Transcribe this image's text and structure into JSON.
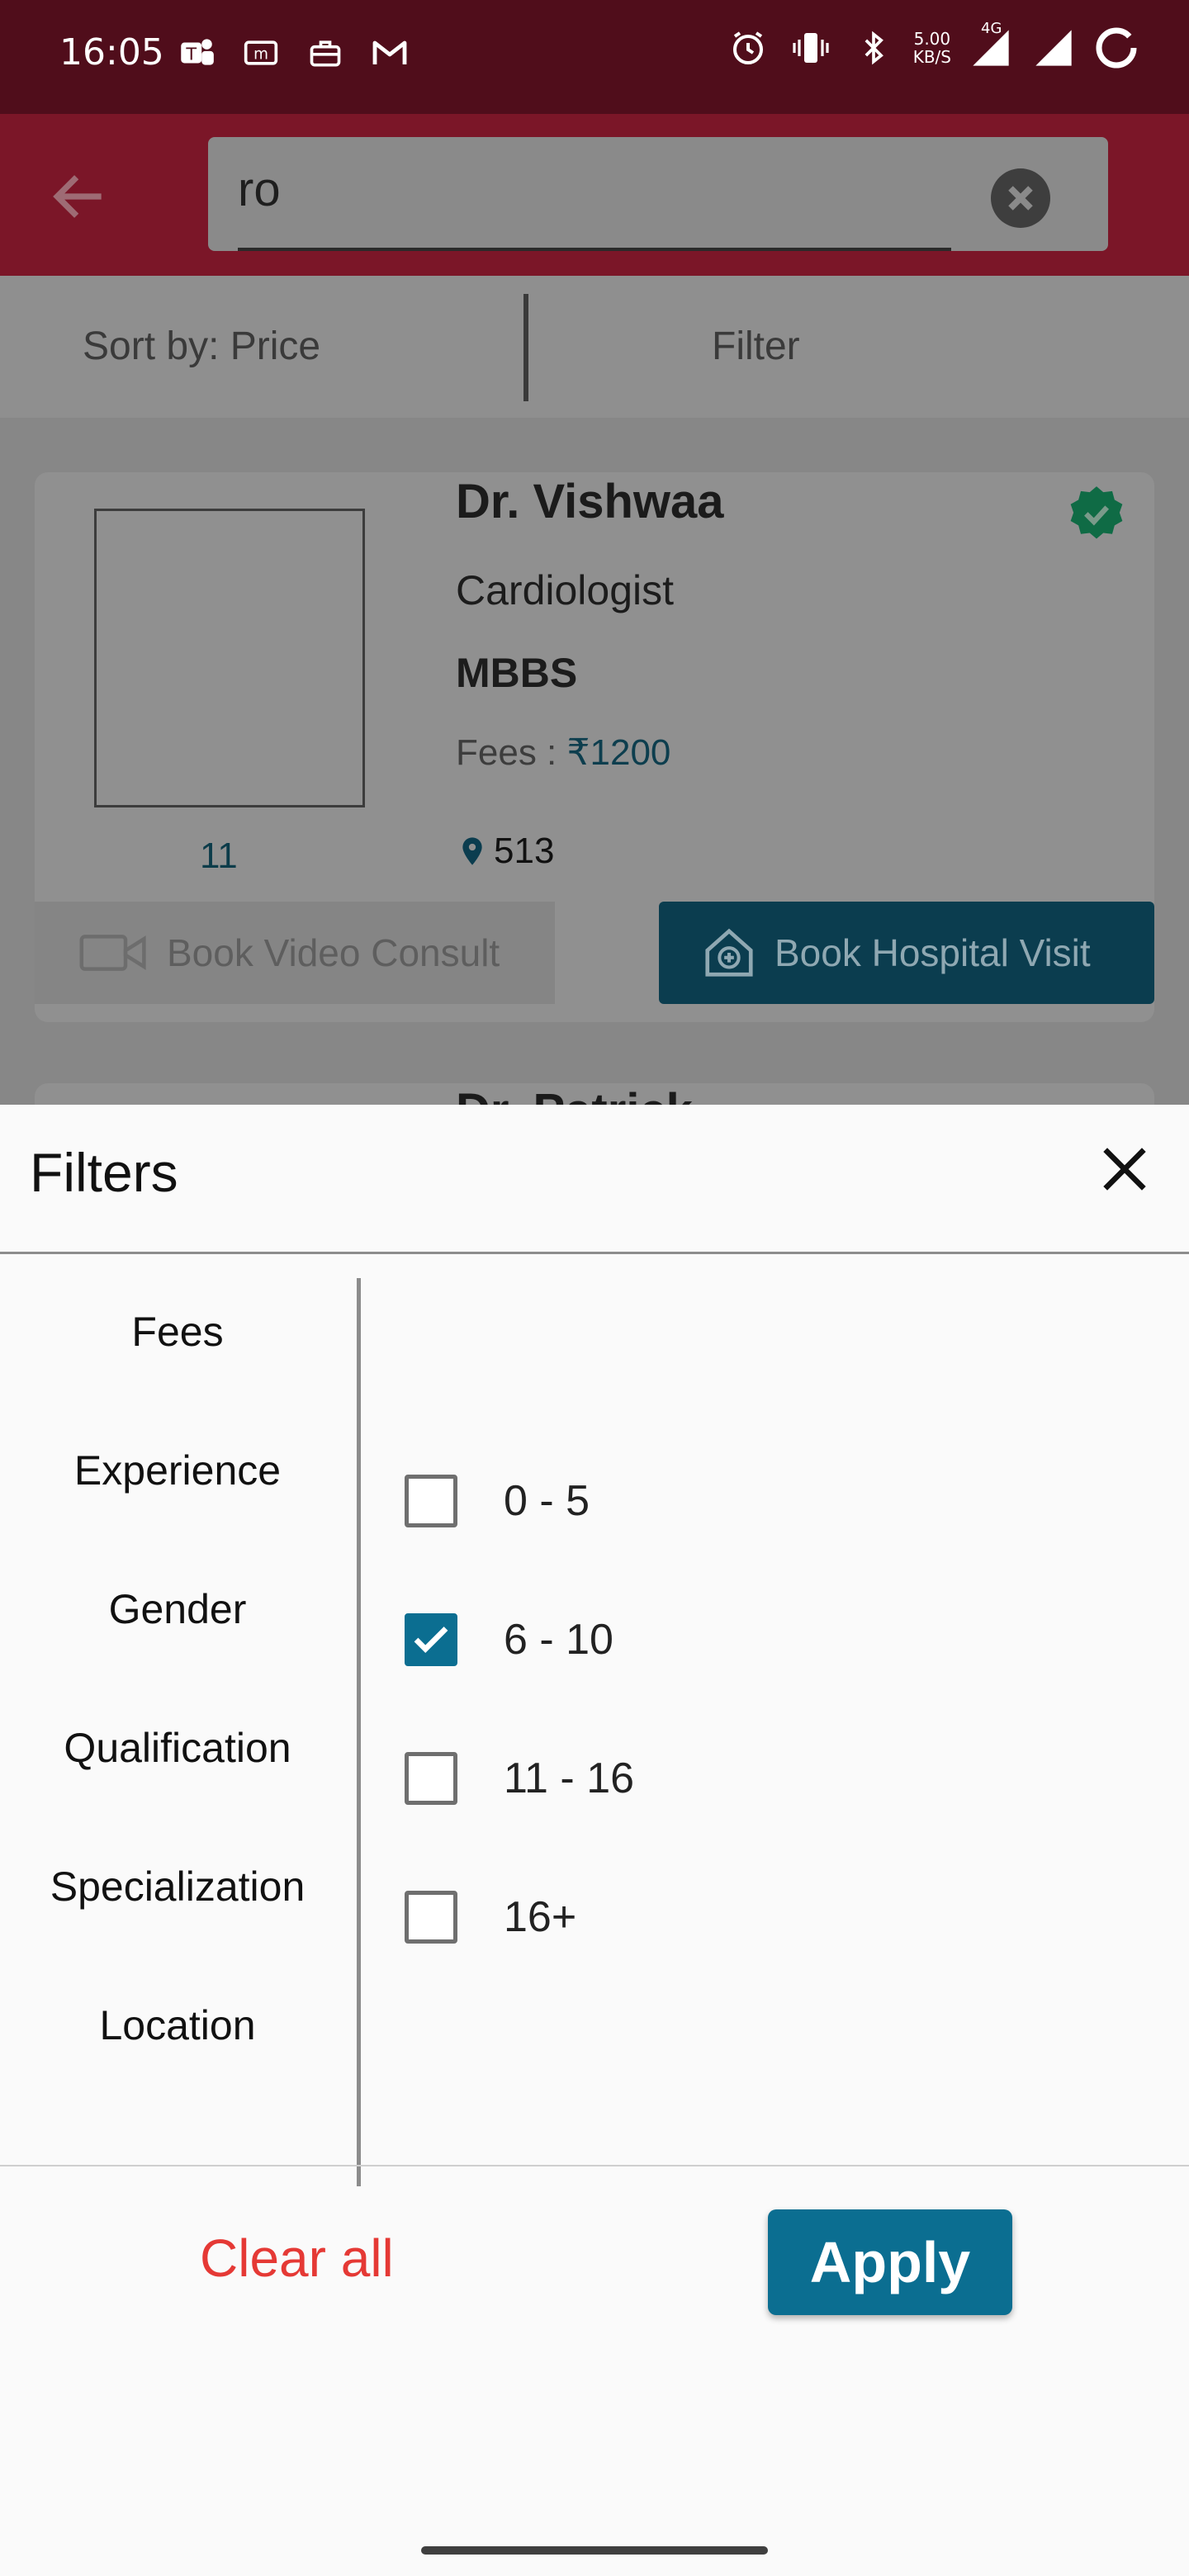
{
  "status_bar": {
    "time": "16:05",
    "net_speed_top": "5.00",
    "net_speed_bottom": "KB/S",
    "network": "4G"
  },
  "search": {
    "query": "ro"
  },
  "sort_bar": {
    "sort_label": "Sort by: Price",
    "filter_label": "Filter"
  },
  "doctor_card": {
    "name": "Dr. Vishwaa",
    "specialization": "Cardiologist",
    "qualification": "MBBS",
    "fees_label": "Fees : ",
    "currency": "₹",
    "fees_amount": "1200",
    "experience": "11",
    "location": "513",
    "video_button": "Book Video Consult",
    "hospital_button": "Book Hospital Visit"
  },
  "next_card": {
    "name": "Dr. Patrick"
  },
  "filters": {
    "title": "Filters",
    "categories": [
      "Fees",
      "Experience",
      "Gender",
      "Qualification",
      "Specialization",
      "Location"
    ],
    "options": [
      {
        "label": "0 - 5",
        "checked": false
      },
      {
        "label": "6 - 10",
        "checked": true
      },
      {
        "label": "11 - 16",
        "checked": false
      },
      {
        "label": "16+",
        "checked": false
      }
    ],
    "clear_all": "Clear all",
    "apply": "Apply"
  },
  "colors": {
    "status_bar": "#500d1b",
    "app_bar": "#7b1628",
    "accent": "#0b6e91",
    "clear_all": "#e53935"
  }
}
